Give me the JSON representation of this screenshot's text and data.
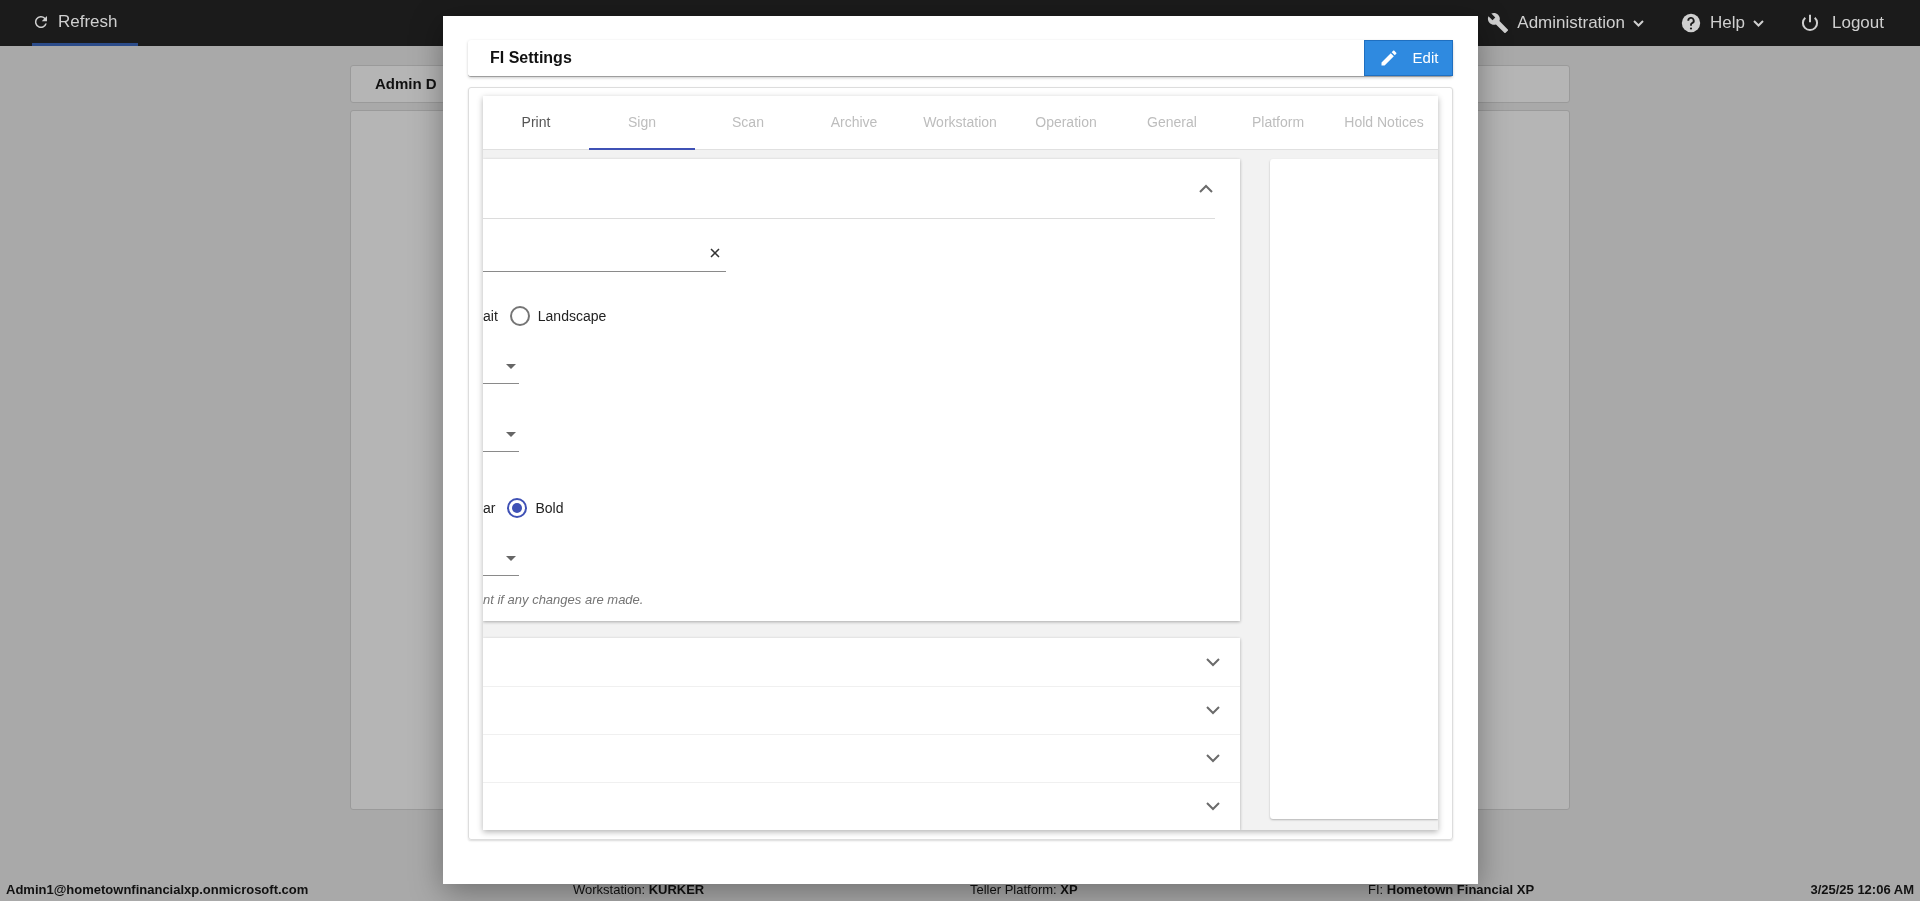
{
  "top_bar": {
    "refresh": "Refresh",
    "menus": [
      {
        "label": "Administration",
        "kind": "wrench"
      },
      {
        "label": "Help",
        "kind": "help"
      }
    ],
    "logout": "Logout"
  },
  "background_card": {
    "title": "Admin D"
  },
  "modal": {
    "title": "FI Settings",
    "edit_button": "Edit",
    "tabs": [
      {
        "label": "Print",
        "selected": false,
        "disabled": false
      },
      {
        "label": "Sign",
        "selected": true,
        "disabled": true
      },
      {
        "label": "Scan",
        "selected": false,
        "disabled": true
      },
      {
        "label": "Archive",
        "selected": false,
        "disabled": true
      },
      {
        "label": "Workstation",
        "selected": false,
        "disabled": true
      },
      {
        "label": "Operation",
        "selected": false,
        "disabled": true
      },
      {
        "label": "General",
        "selected": false,
        "disabled": true
      },
      {
        "label": "Platform",
        "selected": false,
        "disabled": true
      },
      {
        "label": "Hold Notices",
        "selected": false,
        "disabled": true
      }
    ],
    "section": {
      "expanded": true,
      "fields": [
        {
          "kind": "text"
        },
        {
          "kind": "radio",
          "options": [
            {
              "label": "ait"
            },
            {
              "label": "Landscape",
              "selected": false
            }
          ]
        },
        {
          "kind": "select"
        },
        {
          "kind": "select"
        },
        {
          "kind": "radio",
          "options": [
            {
              "label": "ar"
            },
            {
              "label": "Bold",
              "selected": true
            }
          ]
        },
        {
          "kind": "select"
        }
      ],
      "note": "nt if any changes are made."
    },
    "collapsed_sections": [
      {
        "expanded": false
      },
      {
        "expanded": false
      },
      {
        "expanded": false
      },
      {
        "expanded": false
      }
    ]
  },
  "status_bar": {
    "user": "Admin1@hometownfinancialxp.onmicrosoft.com",
    "workstation": "Workstation: **KURKER**",
    "platform": "Teller Platform: **XP**",
    "fi": "FI: **Hometown Financial XP**",
    "datetime": "3/25/25 12:06 AM"
  }
}
